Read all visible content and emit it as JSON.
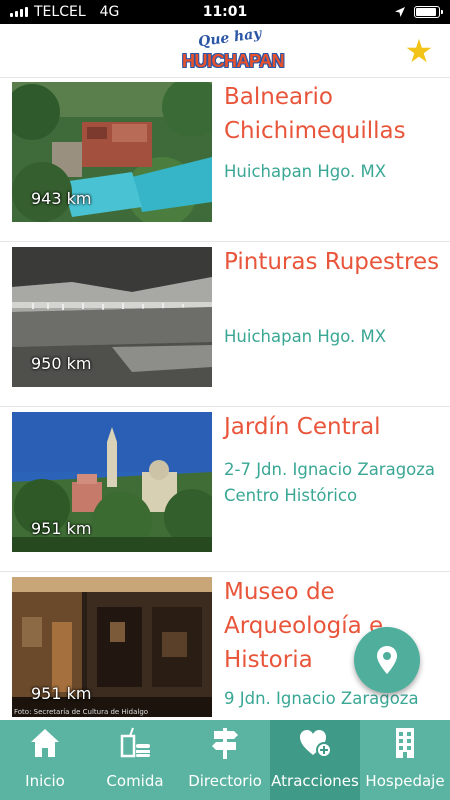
{
  "status_bar": {
    "carrier": "TELCEL",
    "network": "4G",
    "time": "11:01",
    "battery_level": 0.9
  },
  "header": {
    "logo_top": "Que hay",
    "logo_main": "HUICHAPAN",
    "favorite_icon": "star-icon"
  },
  "attractions": [
    {
      "title": "Balneario Chichimequillas",
      "address": "Huichapan Hgo. MX",
      "distance": "943 km",
      "image": "pool-resort-photo"
    },
    {
      "title": "Pinturas Rupestres",
      "address": "Huichapan Hgo. MX",
      "distance": "950 km",
      "image": "rock-paintings-photo"
    },
    {
      "title": "Jardín Central",
      "address": "2-7 Jdn. Ignacio Zaragoza Centro Histórico",
      "distance": "951 km",
      "image": "town-square-photo"
    },
    {
      "title": "Museo de Arqueología e Historia",
      "address": "9 Jdn. Ignacio Zaragoza",
      "distance": "951 km",
      "image": "museum-interior-photo",
      "credit": "Foto: Secretaría de Cultura de Hidalgo"
    }
  ],
  "fab": {
    "icon": "map-pin-icon"
  },
  "bottom_nav": [
    {
      "label": "Inicio",
      "icon": "home-icon",
      "active": false
    },
    {
      "label": "Comida",
      "icon": "food-drink-icon",
      "active": false
    },
    {
      "label": "Directorio",
      "icon": "signpost-icon",
      "active": false
    },
    {
      "label": "Atracciones",
      "icon": "heart-plus-icon",
      "active": true
    },
    {
      "label": "Hospedaje",
      "icon": "hotel-icon",
      "active": false
    }
  ],
  "colors": {
    "accent": "#e8553a",
    "teal": "#3aa795",
    "nav_bg": "#5bb4a1",
    "nav_active": "#3f9b88",
    "star": "#f2c318"
  }
}
